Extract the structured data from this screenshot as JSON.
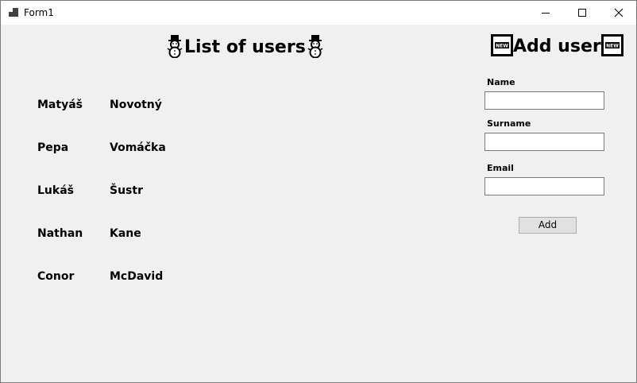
{
  "window": {
    "title": "Form1"
  },
  "list": {
    "heading": "List of users",
    "users": [
      {
        "first": "Matyáš",
        "last": "Novotný"
      },
      {
        "first": "Pepa",
        "last": "Vomáčka"
      },
      {
        "first": "Lukáš",
        "last": "Šustr"
      },
      {
        "first": "Nathan",
        "last": "Kane"
      },
      {
        "first": "Conor",
        "last": "McDavid"
      }
    ]
  },
  "form": {
    "heading": "Add user",
    "name_label": "Name",
    "name_value": "",
    "surname_label": "Surname",
    "surname_value": "",
    "email_label": "Email",
    "email_value": "",
    "add_button_label": "Add"
  },
  "icons": {
    "heading_left": "snowman-icon",
    "heading_right": "new-badge-icon"
  }
}
